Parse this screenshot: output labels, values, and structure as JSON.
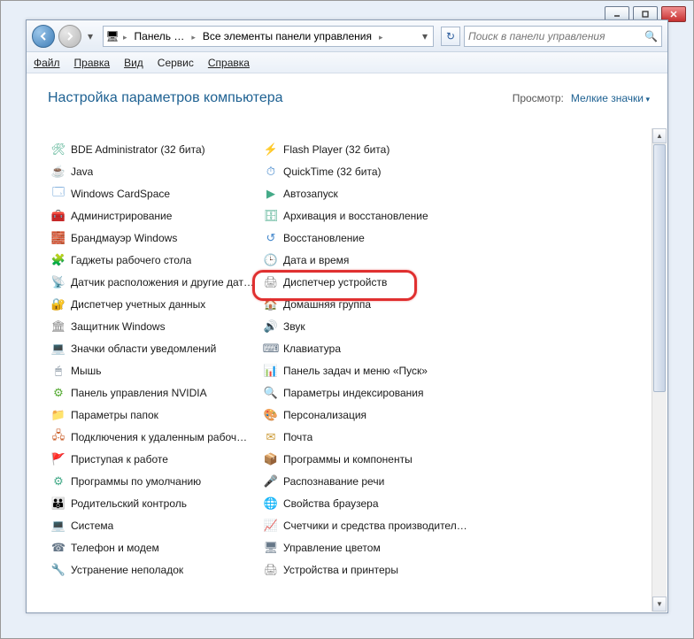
{
  "titlebar": {
    "minimize": "_",
    "maximize": "□",
    "close": "×"
  },
  "breadcrumb": {
    "icon": "⚙",
    "seg1": "Панель …",
    "seg2": "Все элементы панели управления"
  },
  "search": {
    "placeholder": "Поиск в панели управления"
  },
  "menu": {
    "file": "Файл",
    "edit": "Правка",
    "view": "Вид",
    "tools": "Сервис",
    "help": "Справка"
  },
  "header": {
    "title": "Настройка параметров компьютера",
    "view_label": "Просмотр:",
    "view_value": "Мелкие значки"
  },
  "items_left": [
    {
      "icon": "🛠",
      "c": "#4a8",
      "label": "BDE Administrator (32 бита)"
    },
    {
      "icon": "☕",
      "c": "#b52",
      "label": "Java"
    },
    {
      "icon": "🗔",
      "c": "#48c",
      "label": "Windows CardSpace"
    },
    {
      "icon": "🧰",
      "c": "#888",
      "label": "Администрирование"
    },
    {
      "icon": "🧱",
      "c": "#c63",
      "label": "Брандмауэр Windows"
    },
    {
      "icon": "🧩",
      "c": "#c63",
      "label": "Гаджеты рабочего стола"
    },
    {
      "icon": "📡",
      "c": "#7a3",
      "label": "Датчик расположения и другие дат…"
    },
    {
      "icon": "🔐",
      "c": "#a83",
      "label": "Диспетчер учетных данных"
    },
    {
      "icon": "🏛",
      "c": "#888",
      "label": "Защитник Windows"
    },
    {
      "icon": "💻",
      "c": "#678",
      "label": "Значки области уведомлений"
    },
    {
      "icon": "🖱",
      "c": "#678",
      "label": "Мышь"
    },
    {
      "icon": "⚙",
      "c": "#5a3",
      "label": "Панель управления NVIDIA"
    },
    {
      "icon": "📁",
      "c": "#c93",
      "label": "Параметры папок"
    },
    {
      "icon": "🖧",
      "c": "#c63",
      "label": "Подключения к удаленным рабоч…"
    },
    {
      "icon": "🚩",
      "c": "#8a3",
      "label": "Приступая к работе"
    },
    {
      "icon": "⚙",
      "c": "#4a8",
      "label": "Программы по умолчанию"
    },
    {
      "icon": "👪",
      "c": "#c55",
      "label": "Родительский контроль"
    },
    {
      "icon": "💻",
      "c": "#48c",
      "label": "Система"
    },
    {
      "icon": "☎",
      "c": "#678",
      "label": "Телефон и модем"
    },
    {
      "icon": "🔧",
      "c": "#48c",
      "label": "Устранение неполадок"
    }
  ],
  "items_right": [
    {
      "icon": "⚡",
      "c": "#c33",
      "label": "Flash Player (32 бита)"
    },
    {
      "icon": "⏱",
      "c": "#48c",
      "label": "QuickTime (32 бита)"
    },
    {
      "icon": "▶",
      "c": "#4a8",
      "label": "Автозапуск"
    },
    {
      "icon": "🗄",
      "c": "#4a8",
      "label": "Архивация и восстановление"
    },
    {
      "icon": "↺",
      "c": "#48c",
      "label": "Восстановление"
    },
    {
      "icon": "🕒",
      "c": "#888",
      "label": "Дата и время"
    },
    {
      "icon": "🖨",
      "c": "#888",
      "label": "Диспетчер устройств",
      "hl": true
    },
    {
      "icon": "🏠",
      "c": "#c93",
      "label": "Домашняя группа"
    },
    {
      "icon": "🔊",
      "c": "#888",
      "label": "Звук"
    },
    {
      "icon": "⌨",
      "c": "#678",
      "label": "Клавиатура"
    },
    {
      "icon": "📊",
      "c": "#678",
      "label": "Панель задач и меню «Пуск»"
    },
    {
      "icon": "🔍",
      "c": "#c93",
      "label": "Параметры индексирования"
    },
    {
      "icon": "🎨",
      "c": "#c55",
      "label": "Персонализация"
    },
    {
      "icon": "✉",
      "c": "#c93",
      "label": "Почта"
    },
    {
      "icon": "📦",
      "c": "#c93",
      "label": "Программы и компоненты"
    },
    {
      "icon": "🎤",
      "c": "#4a8",
      "label": "Распознавание речи"
    },
    {
      "icon": "🌐",
      "c": "#48c",
      "label": "Свойства браузера"
    },
    {
      "icon": "📈",
      "c": "#48c",
      "label": "Счетчики и средства производител…"
    },
    {
      "icon": "🖥",
      "c": "#678",
      "label": "Управление цветом"
    },
    {
      "icon": "🖨",
      "c": "#888",
      "label": "Устройства и принтеры"
    }
  ]
}
